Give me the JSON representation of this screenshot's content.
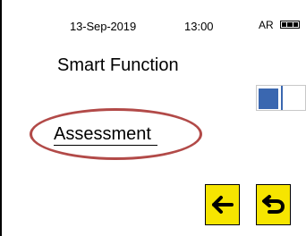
{
  "status_bar": {
    "date": "13-Sep-2019",
    "time": "13:00",
    "indicator": "AR",
    "battery_icon": "battery-icon"
  },
  "screen": {
    "title": "Smart Function"
  },
  "toggle": {
    "state": "off"
  },
  "menu": {
    "selected_item": "Assessment "
  },
  "highlight": {
    "color": "#b24a48"
  },
  "nav": {
    "back_icon": "arrow-left-icon",
    "undo_icon": "return-icon",
    "button_color": "#f6e500"
  }
}
